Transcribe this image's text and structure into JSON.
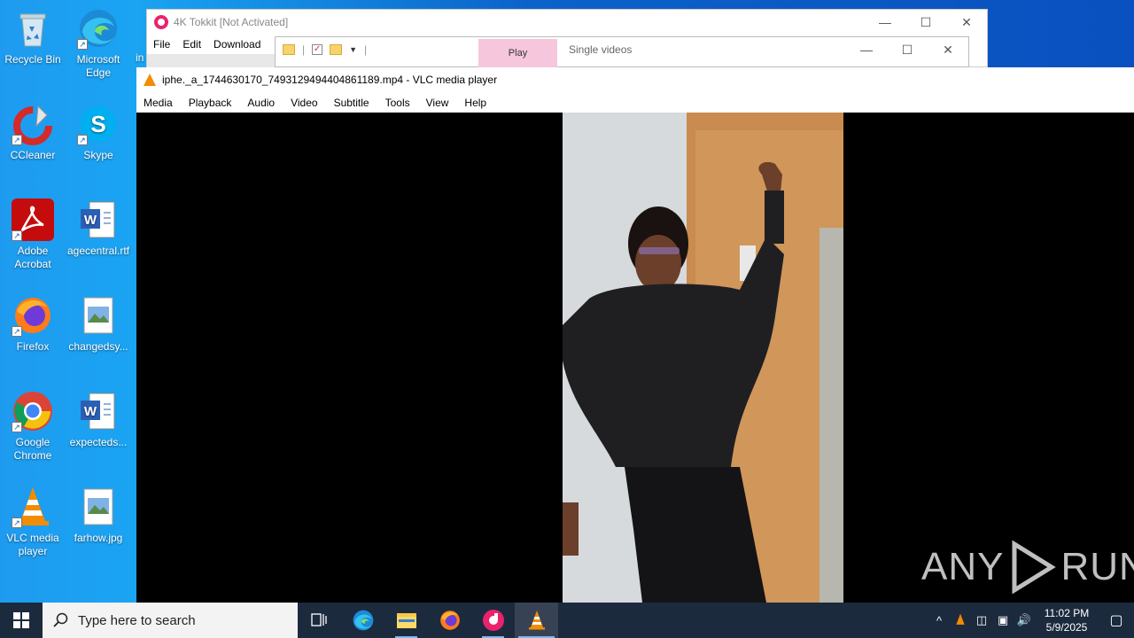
{
  "desktop": {
    "icons": [
      {
        "label": "Recycle Bin"
      },
      {
        "label": "Microsoft Edge"
      },
      {
        "label": "CCleaner"
      },
      {
        "label": "Skype"
      },
      {
        "label": "Adobe Acrobat"
      },
      {
        "label": "agecentral.rtf"
      },
      {
        "label": "Firefox"
      },
      {
        "label": "changedsy..."
      },
      {
        "label": "Google Chrome"
      },
      {
        "label": "expecteds..."
      },
      {
        "label": "VLC media player"
      },
      {
        "label": "farhow.jpg"
      }
    ],
    "edge_fragment": "in"
  },
  "tokkit": {
    "title": "4K Tokkit [Not Activated]",
    "menu": [
      "File",
      "Edit",
      "Download"
    ]
  },
  "explorer": {
    "play_tab": "Play",
    "single_videos": "Single videos"
  },
  "vlc": {
    "title": "iphe._a_1744630170_7493129494404861189.mp4 - VLC media player",
    "menu": [
      "Media",
      "Playback",
      "Audio",
      "Video",
      "Subtitle",
      "Tools",
      "View",
      "Help"
    ]
  },
  "watermark": {
    "text": "ANY",
    "text2": "RUN"
  },
  "taskbar": {
    "search_placeholder": "Type here to search",
    "time": "11:02 PM",
    "date": "5/9/2025"
  },
  "colors": {
    "desktop_blue": "#1a8fe3",
    "taskbar": "#1c2a3e",
    "tokkit_pink": "#e8236b",
    "vlc_orange": "#f28c00"
  }
}
